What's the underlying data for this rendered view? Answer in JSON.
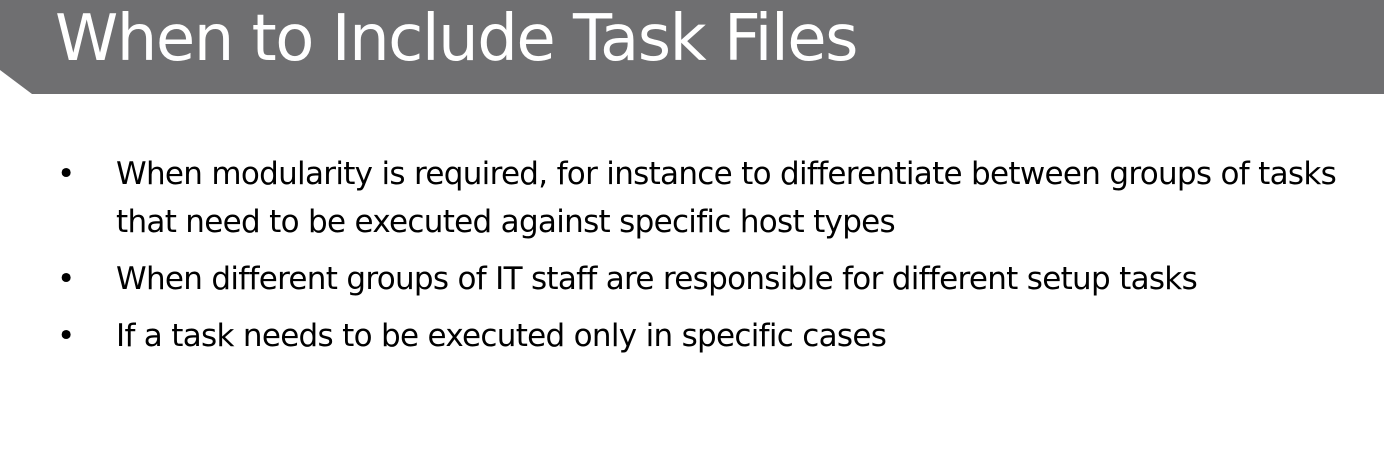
{
  "slide": {
    "title": "When to Include Task Files",
    "bullets": [
      {
        "marker": "•",
        "text": "When modularity is required, for instance to differentiate between groups of tasks that need to be executed against specific host types"
      },
      {
        "marker": "•",
        "text": "When different groups of IT staff are responsible for different setup tasks"
      },
      {
        "marker": "•",
        "text": "If a task needs to be executed only in specific cases"
      }
    ]
  },
  "colors": {
    "title_bar": "#6f6f71",
    "title_text": "#ffffff",
    "body_text": "#000000",
    "background": "#ffffff"
  }
}
